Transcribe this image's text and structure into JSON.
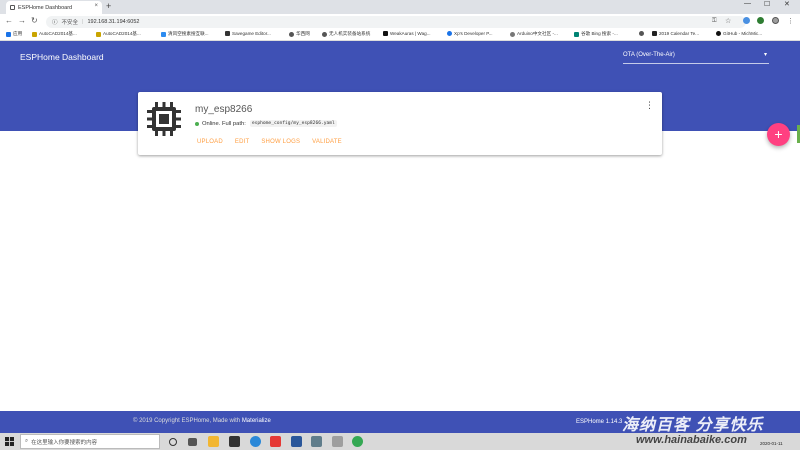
{
  "browser": {
    "tab_title": "ESPHome Dashboard",
    "tab_close": "×",
    "new_tab": "+",
    "security_label": "不安全",
    "url": "192.168.31.194:6052",
    "window_controls": [
      "—",
      "☐",
      "✕"
    ]
  },
  "bookmarks": [
    {
      "label": "应用",
      "color": "#1a73e8"
    },
    {
      "label": "AutoCAD2014基...",
      "color": "#c9a400"
    },
    {
      "label": "AutoCAD2014基...",
      "color": "#c9a400"
    },
    {
      "label": "清风空搜素搜互联...",
      "color": "#2d8cf0"
    },
    {
      "label": "Savegame Editor...",
      "color": "#333333"
    },
    {
      "label": "华西网",
      "color": "#555555"
    },
    {
      "label": "无人机实装备站系统",
      "color": "#555555"
    },
    {
      "label": "WeakAuras | Wag...",
      "color": "#111111"
    },
    {
      "label": "Xp's Developer P...",
      "color": "#1a73e8"
    },
    {
      "label": "Arduino中文社区 -...",
      "color": "#777777"
    },
    {
      "label": "谷歌 Bing 搜索 -...",
      "color": "#008373"
    },
    {
      "label": "",
      "color": "#555555"
    },
    {
      "label": "2019 Calendar Te...",
      "color": "#222222"
    },
    {
      "label": "GitHub - MichMic...",
      "color": "#111111"
    }
  ],
  "header": {
    "brand": "ESPHome Dashboard",
    "upload_port_select": "OTA (Over-The-Air)"
  },
  "device": {
    "name": "my_esp8266",
    "status_text": "Online. Full path:",
    "full_path": "esphome_config/my_esp8266.yaml",
    "menu_icon": "⋮",
    "actions": [
      "UPLOAD",
      "EDIT",
      "SHOW LOGS",
      "VALIDATE"
    ]
  },
  "fab_label": "+",
  "footer": {
    "copyright_prefix": "© 2019 Copyright ESPHome, Made with ",
    "copyright_link": "Materialize",
    "version": "ESPHome 1.14.3",
    "watermark": "海纳百客 分享快乐"
  },
  "taskbar": {
    "search_placeholder": "在这里输入你要搜索的内容",
    "watermark_url": "www.hainabaike.com",
    "clock": "2020-01-11"
  },
  "colors": {
    "primary": "#3f51b5",
    "accent": "#ff4081",
    "action": "#ff9f43",
    "online": "#4caf50"
  }
}
